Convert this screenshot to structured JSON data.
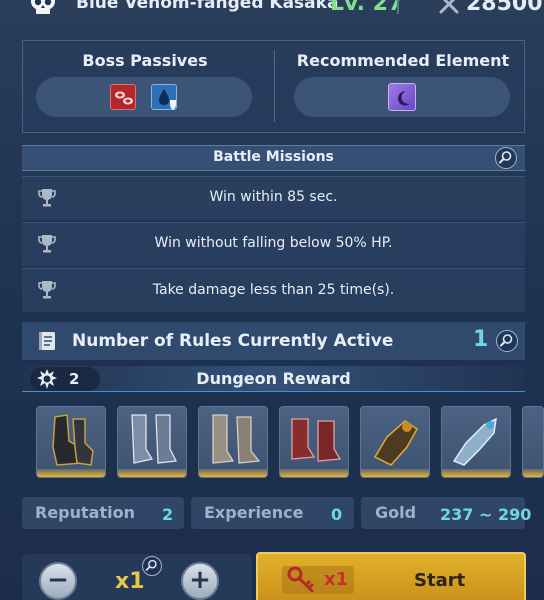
{
  "header": {
    "boss_name": "Blue Venom-fanged Kasaka",
    "level": "Lv. 27",
    "power": "28500"
  },
  "boss_passives": {
    "title": "Boss Passives",
    "icons": [
      "bleed-passive-icon",
      "water-shield-passive-icon"
    ]
  },
  "recommended_element": {
    "title": "Recommended Element",
    "icons": [
      "dark-moon-element-icon"
    ]
  },
  "battle_missions": {
    "title": "Battle Missions",
    "missions": [
      "Win within 85 sec.",
      "Win without falling below 50% HP.",
      "Take damage less than 25 time(s)."
    ]
  },
  "rules": {
    "label": "Number of Rules Currently Active",
    "count": "1"
  },
  "dungeon_reward": {
    "title": "Dungeon Reward",
    "badge_count": "2",
    "items": [
      "dark-gauntlet-icon",
      "silver-greaves-icon",
      "iron-boots-icon",
      "crimson-boots-icon",
      "golden-gauntlet-icon",
      "azure-vambrace-icon"
    ],
    "reputation_label": "Reputation",
    "reputation_value": "2",
    "experience_label": "Experience",
    "experience_value": "0",
    "gold_label": "Gold",
    "gold_value": "237 ~ 290"
  },
  "controls": {
    "minus": "−",
    "plus": "+",
    "quantity": "x1",
    "key_quantity": "x1",
    "start_label": "Start"
  },
  "colors": {
    "accent_cyan": "#6fd6e6",
    "level_green": "#7fe08f",
    "start_gold": "#e2b02c"
  }
}
